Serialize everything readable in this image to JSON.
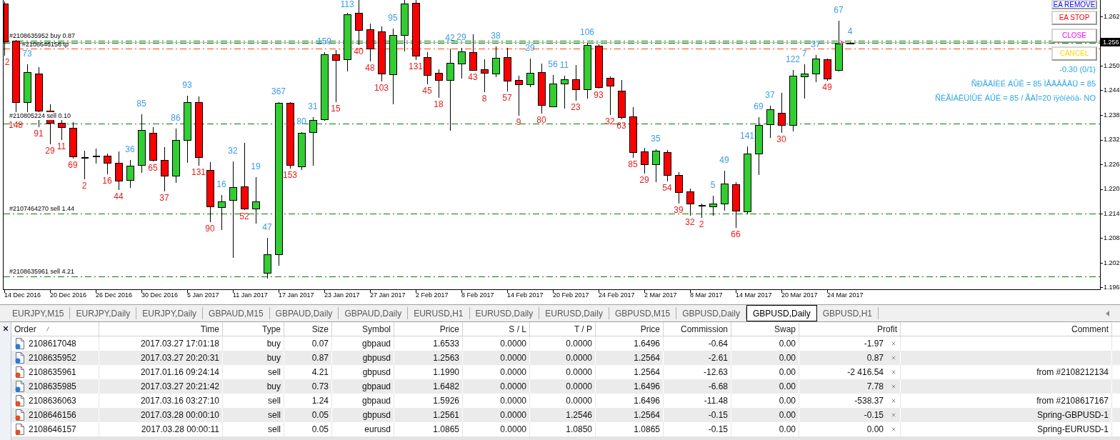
{
  "chart": {
    "order_lines": [
      {
        "label": "#2108635952 buy 0.87",
        "kind": "entry"
      },
      {
        "label": "#2108646156 tp",
        "kind": "tp"
      },
      {
        "label": "#210805224 sell 0.10",
        "kind": "entry"
      },
      {
        "label": "#2107464270 sell 1.44",
        "kind": "entry"
      },
      {
        "label": "#2108635961 sell 4.21",
        "kind": "entry"
      }
    ],
    "candle_labels": [
      {
        "text": "2",
        "kind": "low"
      },
      {
        "text": "148",
        "kind": "low"
      },
      {
        "text": "73",
        "kind": "high"
      },
      {
        "text": "91",
        "kind": "low"
      },
      {
        "text": "29",
        "kind": "low"
      },
      {
        "text": "11",
        "kind": "low"
      },
      {
        "text": "69",
        "kind": "low"
      },
      {
        "text": "2",
        "kind": "low"
      },
      {
        "text": "16",
        "kind": "low"
      },
      {
        "text": "44",
        "kind": "low"
      },
      {
        "text": "36",
        "kind": "high"
      },
      {
        "text": "85",
        "kind": "high"
      },
      {
        "text": "65",
        "kind": "low"
      },
      {
        "text": "37",
        "kind": "low"
      },
      {
        "text": "86",
        "kind": "high"
      },
      {
        "text": "93",
        "kind": "high"
      },
      {
        "text": "131",
        "kind": "low"
      },
      {
        "text": "90",
        "kind": "low"
      },
      {
        "text": "16",
        "kind": "high"
      },
      {
        "text": "32",
        "kind": "high"
      },
      {
        "text": "52",
        "kind": "low"
      },
      {
        "text": "19",
        "kind": "high"
      },
      {
        "text": "47",
        "kind": "high"
      },
      {
        "text": "367",
        "kind": "high"
      },
      {
        "text": "153",
        "kind": "low"
      },
      {
        "text": "80",
        "kind": "high"
      },
      {
        "text": "31",
        "kind": "high"
      },
      {
        "text": "159",
        "kind": "high"
      },
      {
        "text": "15",
        "kind": "low"
      },
      {
        "text": "113",
        "kind": "high"
      },
      {
        "text": "40",
        "kind": "low"
      },
      {
        "text": "48",
        "kind": "low"
      },
      {
        "text": "103",
        "kind": "low"
      },
      {
        "text": "95",
        "kind": "high"
      },
      {
        "text": "131",
        "kind": "low"
      },
      {
        "text": "45",
        "kind": "low"
      },
      {
        "text": "18",
        "kind": "low"
      },
      {
        "text": "42",
        "kind": "high"
      },
      {
        "text": "29",
        "kind": "high"
      },
      {
        "text": "43",
        "kind": "low"
      },
      {
        "text": "8",
        "kind": "low"
      },
      {
        "text": "38",
        "kind": "high"
      },
      {
        "text": "57",
        "kind": "low"
      },
      {
        "text": "9",
        "kind": "low"
      },
      {
        "text": "29",
        "kind": "high"
      },
      {
        "text": "80",
        "kind": "low"
      },
      {
        "text": "56",
        "kind": "high"
      },
      {
        "text": "11",
        "kind": "high"
      },
      {
        "text": "23",
        "kind": "low"
      },
      {
        "text": "106",
        "kind": "high"
      },
      {
        "text": "93",
        "kind": "low"
      },
      {
        "text": "32",
        "kind": "low"
      },
      {
        "text": "63",
        "kind": "low"
      },
      {
        "text": "85",
        "kind": "low"
      },
      {
        "text": "29",
        "kind": "low"
      },
      {
        "text": "35",
        "kind": "high"
      },
      {
        "text": "54",
        "kind": "low"
      },
      {
        "text": "39",
        "kind": "low"
      },
      {
        "text": "32",
        "kind": "low"
      },
      {
        "text": "2",
        "kind": "low"
      },
      {
        "text": "5",
        "kind": "high"
      },
      {
        "text": "49",
        "kind": "high"
      },
      {
        "text": "66",
        "kind": "low"
      },
      {
        "text": "141",
        "kind": "high"
      },
      {
        "text": "69",
        "kind": "high"
      },
      {
        "text": "37",
        "kind": "high"
      },
      {
        "text": "30",
        "kind": "low"
      },
      {
        "text": "122",
        "kind": "high"
      },
      {
        "text": "7",
        "kind": "high"
      },
      {
        "text": "37",
        "kind": "high"
      },
      {
        "text": "49",
        "kind": "low"
      },
      {
        "text": "67",
        "kind": "high"
      },
      {
        "text": "4",
        "kind": "high"
      }
    ],
    "buttons": [
      {
        "label": "EA REMOVE",
        "color": "#0000ff"
      },
      {
        "label": "EA STOP",
        "color": "#ff0000"
      },
      {
        "label": "CLOSE",
        "color": "#ff00ff"
      },
      {
        "label": "CANCEL",
        "color": "#ffd700"
      }
    ],
    "info_lines": [
      "-0.30 (0/1)",
      "ÑÐÅÄÍÈÉ ÁÛÊ = 85 ÌÅÄÂÅÄÜ = 85",
      "ÑÈÃÍÀËÜÍÛÉ ÁÛÊ = 85 / ÃÀÏ=20 ïÿòíèöà- NO"
    ],
    "price_axis": {
      "labels": [
        "1.262",
        "1.250",
        "1.244",
        "1.238",
        "1.232",
        "1.226",
        "1.220",
        "1.214",
        "1.208",
        "1.202",
        "1.196"
      ],
      "current": "1.256"
    },
    "date_axis": [
      "14 Dec 2016",
      "20 Dec 2016",
      "26 Dec 2016",
      "30 Dec 2016",
      "5 Jan 2017",
      "11 Jan 2017",
      "17 Jan 2017",
      "23 Jan 2017",
      "27 Jan 2017",
      "2 Feb 2017",
      "8 Feb 2017",
      "14 Feb 2017",
      "20 Feb 2017",
      "24 Feb 2017",
      "2 Mar 2017",
      "8 Mar 2017",
      "14 Mar 2017",
      "20 Mar 2017",
      "24 Mar 2017"
    ]
  },
  "tabs": [
    {
      "label": "EURJPY,M15",
      "selected": false
    },
    {
      "label": "EURJPY,Daily",
      "selected": false
    },
    {
      "label": "EURJPY,Daily",
      "selected": false
    },
    {
      "label": "GBPAUD,M15",
      "selected": false
    },
    {
      "label": "GBPAUD,Daily",
      "selected": false
    },
    {
      "label": "GBPAUD,Daily",
      "selected": false
    },
    {
      "label": "EURUSD,H1",
      "selected": false
    },
    {
      "label": "EURUSD,Daily",
      "selected": false
    },
    {
      "label": "EURUSD,Daily",
      "selected": false
    },
    {
      "label": "GBPUSD,M15",
      "selected": false
    },
    {
      "label": "GBPUSD,Daily",
      "selected": false
    },
    {
      "label": "GBPUSD,Daily",
      "selected": true
    },
    {
      "label": "GBPUSD,H1",
      "selected": false
    }
  ],
  "terminal": {
    "columns": [
      "Order",
      "Time",
      "Type",
      "Size",
      "Symbol",
      "Price",
      "S / L",
      "T / P",
      "Price",
      "Commission",
      "Swap",
      "Profit",
      "Comment"
    ],
    "rows": [
      {
        "kind": "buy",
        "order": "2108617048",
        "time": "2017.03.27 17:01:18",
        "type": "buy",
        "size": "0.07",
        "symbol": "gbpaud",
        "open_price": "1.6533",
        "sl": "0.0000",
        "tp": "0.0000",
        "price": "1.6496",
        "commission": "-0.64",
        "swap": "0.00",
        "profit": "-1.97"
      },
      {
        "kind": "buy",
        "order": "2108635952",
        "time": "2017.03.27 20:20:31",
        "type": "buy",
        "size": "0.87",
        "symbol": "gbpusd",
        "open_price": "1.2563",
        "sl": "0.0000",
        "tp": "0.0000",
        "price": "1.2564",
        "commission": "-2.61",
        "swap": "0.00",
        "profit": "0.87"
      },
      {
        "kind": "sell",
        "order": "2108635961",
        "time": "2017.01.16 09:24:14",
        "type": "sell",
        "size": "4.21",
        "symbol": "gbpusd",
        "open_price": "1.1990",
        "sl": "0.0000",
        "tp": "0.0000",
        "price": "1.2564",
        "commission": "-12.63",
        "swap": "0.00",
        "profit": "-2 416.54",
        "comment": "from #2108212134"
      },
      {
        "kind": "buy",
        "order": "2108635985",
        "time": "2017.03.27 20:21:42",
        "type": "buy",
        "size": "0.73",
        "symbol": "gbpaud",
        "open_price": "1.6482",
        "sl": "0.0000",
        "tp": "0.0000",
        "price": "1.6496",
        "commission": "-6.68",
        "swap": "0.00",
        "profit": "7.78"
      },
      {
        "kind": "sell",
        "order": "2108636063",
        "time": "2017.03.16 03:27:10",
        "type": "sell",
        "size": "1.24",
        "symbol": "gbpaud",
        "open_price": "1.5926",
        "sl": "0.0000",
        "tp": "0.0000",
        "price": "1.6496",
        "commission": "-11.48",
        "swap": "0.00",
        "profit": "-538.37",
        "comment": "from #2108617167"
      },
      {
        "kind": "sell",
        "order": "2108646156",
        "time": "2017.03.28 00:00:10",
        "type": "sell",
        "size": "0.05",
        "symbol": "gbpusd",
        "open_price": "1.2561",
        "sl": "0.0000",
        "tp": "1.2546",
        "price": "1.2564",
        "commission": "-0.15",
        "swap": "0.00",
        "profit": "-0.15",
        "comment": "Spring-GBPUSD-1"
      },
      {
        "kind": "sell",
        "order": "2108646157",
        "time": "2017.03.28 00:00:11",
        "type": "sell",
        "size": "0.05",
        "symbol": "eurusd",
        "open_price": "1.0865",
        "sl": "0.0000",
        "tp": "1.0850",
        "price": "1.0865",
        "commission": "-0.15",
        "swap": "0.00",
        "profit": "0.00",
        "comment": "Spring-EURUSD-1"
      }
    ]
  }
}
